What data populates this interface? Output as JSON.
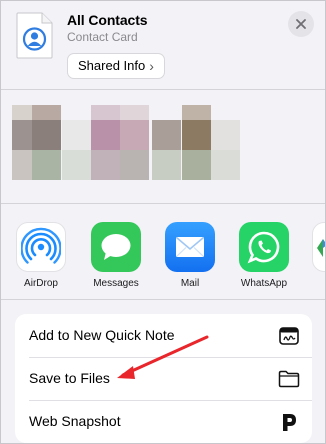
{
  "header": {
    "title": "All Contacts",
    "subtitle": "Contact Card",
    "shared_info_label": "Shared Info",
    "shared_info_chevron": "›",
    "close_icon": "close-icon"
  },
  "apps": [
    {
      "label": "AirDrop",
      "icon": "airdrop-icon",
      "color": "#ffffff"
    },
    {
      "label": "Messages",
      "icon": "messages-icon",
      "color": "#34c759"
    },
    {
      "label": "Mail",
      "icon": "mail-icon",
      "color": "#1a8cff"
    },
    {
      "label": "WhatsApp",
      "icon": "whatsapp-icon",
      "color": "#25d366"
    }
  ],
  "actions": [
    {
      "label": "Add to New Quick Note",
      "icon": "quick-note-icon"
    },
    {
      "label": "Save to Files",
      "icon": "folder-icon"
    },
    {
      "label": "Web Snapshot",
      "icon": "p-icon"
    }
  ],
  "colors": {
    "background": "#f2f2f7",
    "annotation_arrow": "#e8262b"
  }
}
